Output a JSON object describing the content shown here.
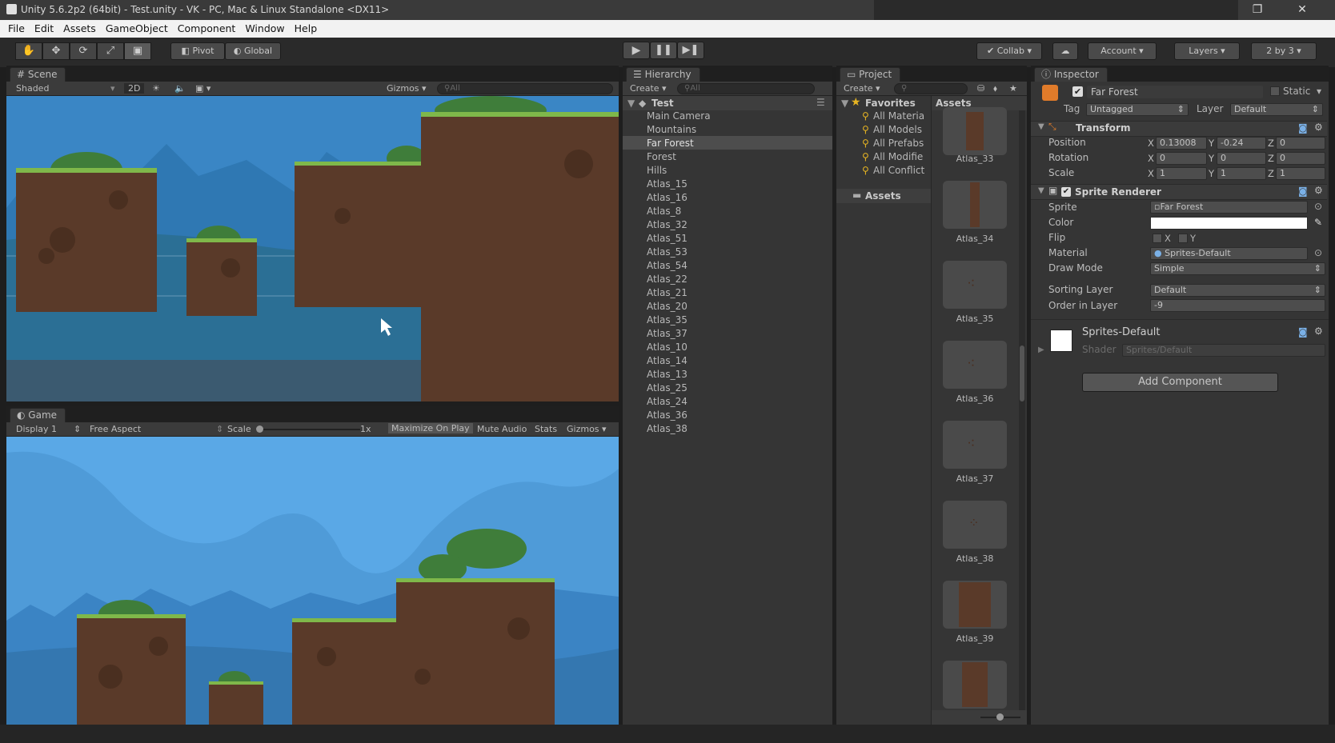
{
  "window": {
    "title": "Unity 5.6.2p2 (64bit) - Test.unity - VK - PC, Mac & Linux Standalone <DX11>"
  },
  "menu": [
    "File",
    "Edit",
    "Assets",
    "GameObject",
    "Component",
    "Window",
    "Help"
  ],
  "toolbar": {
    "pivot": "Pivot",
    "global": "Global",
    "collab": "Collab",
    "account": "Account",
    "layers": "Layers",
    "layout": "2 by 3"
  },
  "scene": {
    "tab": "Scene",
    "shading": "Shaded",
    "mode2d": "2D",
    "gizmos": "Gizmos",
    "search": "All"
  },
  "game": {
    "tab": "Game",
    "display": "Display 1",
    "aspect": "Free Aspect",
    "scale_label": "Scale",
    "scale_value": "1x",
    "maximize": "Maximize On Play",
    "mute": "Mute Audio",
    "stats": "Stats",
    "gizmos": "Gizmos"
  },
  "hierarchy": {
    "tab": "Hierarchy",
    "create": "Create",
    "search": "All",
    "root": "Test",
    "items": [
      "Main Camera",
      "Mountains",
      "Far Forest",
      "Forest",
      "Hills",
      "Atlas_15",
      "Atlas_16",
      "Atlas_8",
      "Atlas_32",
      "Atlas_51",
      "Atlas_53",
      "Atlas_54",
      "Atlas_22",
      "Atlas_21",
      "Atlas_20",
      "Atlas_35",
      "Atlas_37",
      "Atlas_10",
      "Atlas_14",
      "Atlas_13",
      "Atlas_25",
      "Atlas_24",
      "Atlas_36",
      "Atlas_38"
    ],
    "selected": "Far Forest"
  },
  "project": {
    "tab": "Project",
    "create": "Create",
    "favorites_label": "Favorites",
    "favorites": [
      "All Materia",
      "All Models",
      "All Prefabs",
      "All Modifie",
      "All Conflict"
    ],
    "assets_folder": "Assets",
    "assets_header": "Assets",
    "thumbs": [
      "Atlas_33",
      "Atlas_34",
      "Atlas_35",
      "Atlas_36",
      "Atlas_37",
      "Atlas_38",
      "Atlas_39"
    ]
  },
  "inspector": {
    "tab": "Inspector",
    "object_name": "Far Forest",
    "static": "Static",
    "tag_label": "Tag",
    "tag": "Untagged",
    "layer_label": "Layer",
    "layer": "Default",
    "transform": {
      "title": "Transform",
      "position_label": "Position",
      "rotation_label": "Rotation",
      "scale_label": "Scale",
      "position": {
        "x": "0.13008",
        "y": "-0.24",
        "z": "0"
      },
      "rotation": {
        "x": "0",
        "y": "0",
        "z": "0"
      },
      "scale": {
        "x": "1",
        "y": "1",
        "z": "1"
      }
    },
    "sprite_renderer": {
      "title": "Sprite Renderer",
      "sprite_label": "Sprite",
      "sprite": "Far Forest",
      "color_label": "Color",
      "color": "#ffffff",
      "flip_label": "Flip",
      "flip_x": "X",
      "flip_y": "Y",
      "material_label": "Material",
      "material": "Sprites-Default",
      "draw_mode_label": "Draw Mode",
      "draw_mode": "Simple",
      "sorting_layer_label": "Sorting Layer",
      "sorting_layer": "Default",
      "order_label": "Order in Layer",
      "order": "-9"
    },
    "material": {
      "name": "Sprites-Default",
      "shader_label": "Shader",
      "shader": "Sprites/Default"
    },
    "add_component": "Add Component"
  },
  "colors": {
    "sky": "#3a86c5",
    "water": "#2b6f95",
    "ground": "#5a3a29",
    "grass": "#5a8a3a",
    "game_sky": "#5aa8e6"
  }
}
